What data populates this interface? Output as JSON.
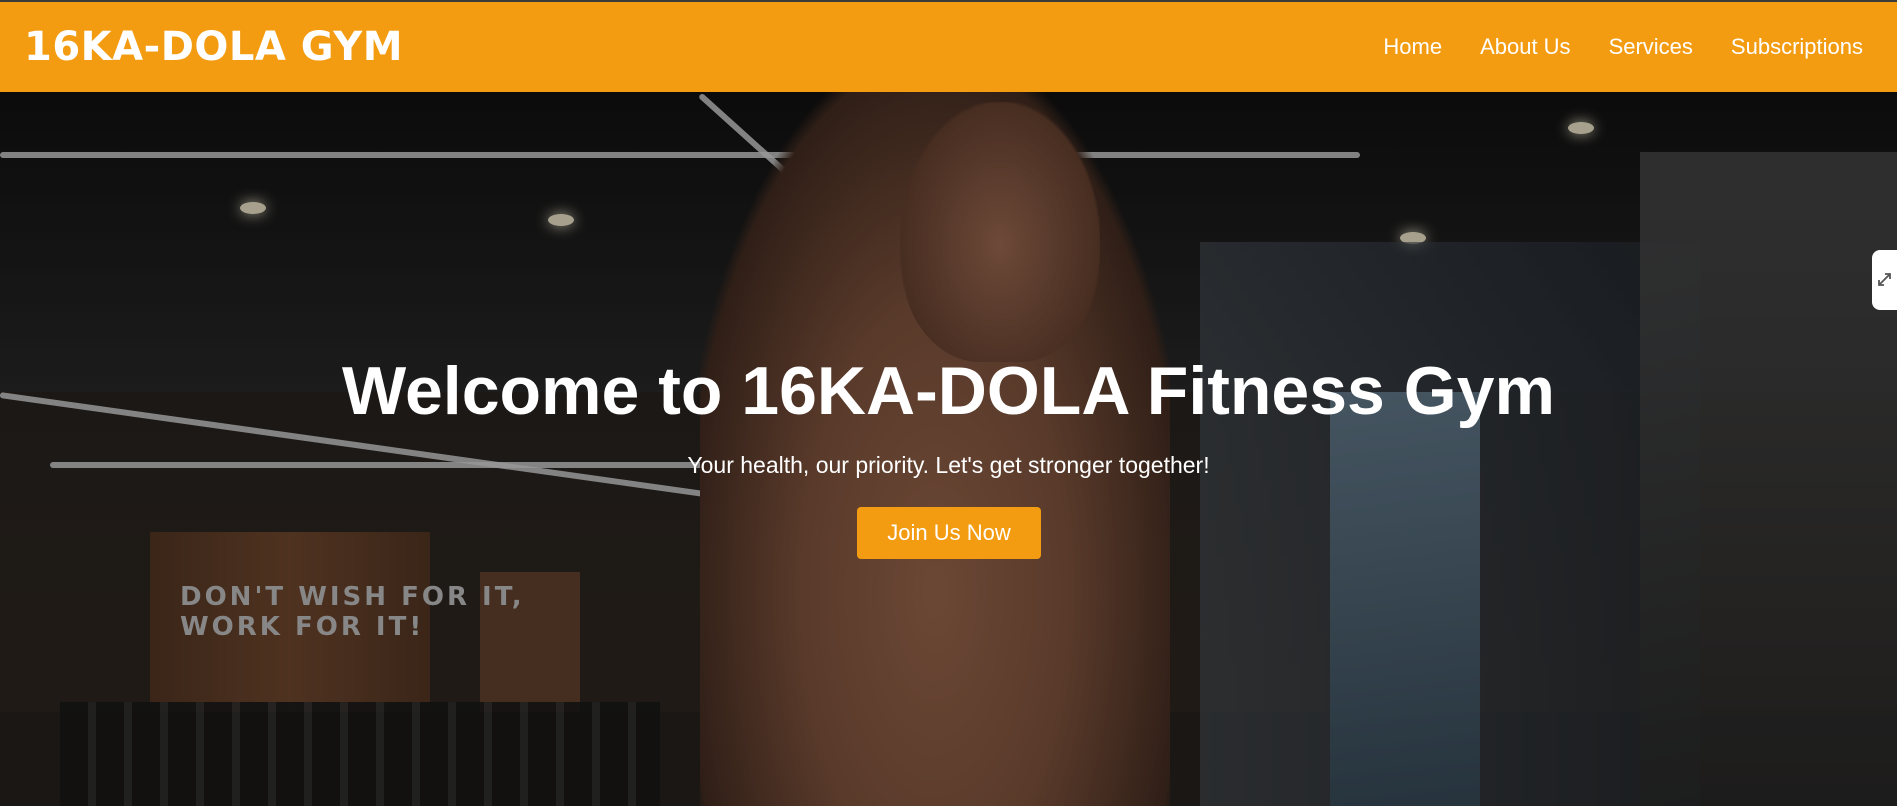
{
  "navbar": {
    "logo": "16KA-DOLA GYM",
    "links": [
      {
        "label": "Home"
      },
      {
        "label": "About Us"
      },
      {
        "label": "Services"
      },
      {
        "label": "Subscriptions"
      }
    ],
    "background_color": "#f39c12"
  },
  "hero": {
    "title": "Welcome to 16KA-DOLA Fitness Gym",
    "subtitle": "Your health, our priority. Let's get stronger together!",
    "cta_label": "Join Us Now",
    "wall_slogan_line1": "DON'T WISH FOR IT,",
    "wall_slogan_line2": "WORK FOR IT!"
  },
  "side_tab": {
    "icon": "expand-arrows-icon"
  }
}
